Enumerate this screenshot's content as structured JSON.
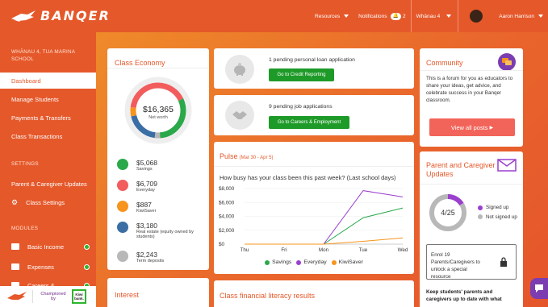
{
  "brand": {
    "name": "BANQER"
  },
  "topnav": {
    "resources": "Resources",
    "notifications": "Notifications",
    "notification_count": "2",
    "class_name": "Whānau 4",
    "user_name": "Aaron Harrison"
  },
  "sidebar": {
    "school": "WHĀNAU 4, TUA MARINA SCHOOL",
    "items": [
      {
        "label": "Dashboard"
      },
      {
        "label": "Manage Students"
      },
      {
        "label": "Payments & Transfers"
      },
      {
        "label": "Class Transactions"
      }
    ],
    "settings_heading": "SETTINGS",
    "settings_items": [
      {
        "label": "Parent & Caregiver Updates"
      },
      {
        "label": "Class Settings"
      }
    ],
    "modules_heading": "MODULES",
    "modules": [
      {
        "label": "Basic Income"
      },
      {
        "label": "Expenses"
      },
      {
        "label": "Careers &"
      }
    ],
    "sponsor_text": "Championed by",
    "sponsor_logo": "Kiwi bank."
  },
  "class_economy": {
    "title": "Class Economy",
    "net_worth_value": "$16,365",
    "net_worth_label": "Net worth",
    "legend": [
      {
        "value": "$5,068",
        "label": "Savings",
        "color": "#2aa84a"
      },
      {
        "value": "$6,709",
        "label": "Everyday",
        "color": "#f25c5c"
      },
      {
        "value": "$887",
        "label": "KiwiSaver",
        "color": "#f7941d"
      },
      {
        "value": "$3,180",
        "label": "Real estate (equity owned by students)",
        "color": "#3a6ea5"
      },
      {
        "value": "$2,243",
        "label": "Term deposits",
        "color": "#b8b8b8"
      }
    ]
  },
  "loan_card": {
    "text": "1 pending personal loan application",
    "button": "Go to Credit Reporting"
  },
  "jobs_card": {
    "text": "9 pending job applications",
    "button": "Go to Careers & Employment"
  },
  "pulse": {
    "title": "Pulse",
    "range": "(Mar 30 - Apr 5)",
    "question": "How busy has your class been this past week? (Last school days)"
  },
  "chart_data": {
    "type": "line",
    "categories": [
      "Thu",
      "Fri",
      "Mon",
      "Tue",
      "Wed"
    ],
    "ylim": [
      0,
      8000
    ],
    "yticks": [
      "$8,000",
      "$6,000",
      "$4,000",
      "$2,000",
      "$0"
    ],
    "series": [
      {
        "name": "Savings",
        "color": "#2aa84a",
        "values": [
          0,
          0,
          0,
          3800,
          5200
        ]
      },
      {
        "name": "Everyday",
        "color": "#9b3fcf",
        "values": [
          0,
          0,
          0,
          7700,
          6800
        ]
      },
      {
        "name": "KiwiSaver",
        "color": "#f7941d",
        "values": [
          0,
          0,
          0,
          400,
          900
        ]
      }
    ]
  },
  "community": {
    "title": "Community",
    "text": "This is a forum for you as educators to share your ideas, get advice, and celebrate success in your Banqer classroom.",
    "button": "View all posts"
  },
  "parent_updates": {
    "title": "Parent and Caregiver Updates",
    "ratio": "4/25",
    "signed_up": "Signed up",
    "not_signed_up": "Not signed up",
    "enrol_text": "Enrol 19 Parents/Caregivers to unlock a special resource",
    "footer_text": "Keep students' parents and caregivers up to date with what"
  },
  "interest": {
    "title": "Interest"
  },
  "literacy": {
    "title": "Class financial literacy results"
  }
}
